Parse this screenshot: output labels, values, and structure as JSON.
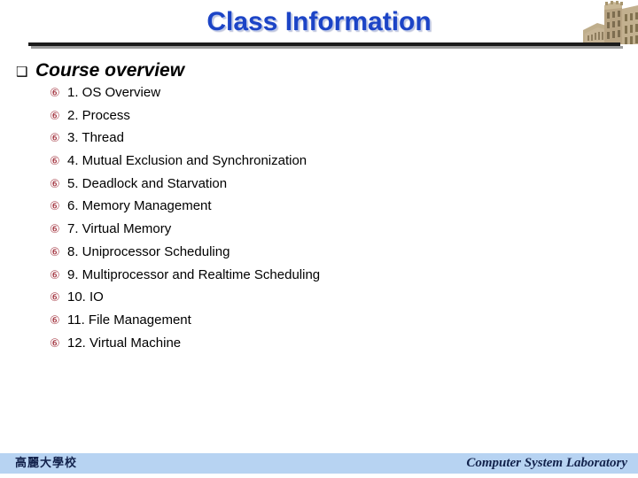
{
  "slide": {
    "title": "Class Information",
    "title_color": "#1c44c6"
  },
  "decor": {
    "building_image_name": "korea-university-building-photo",
    "rule_color": "#1b1b1b"
  },
  "body": {
    "section": {
      "bullet_glyph": "❑",
      "label": "Course overview"
    },
    "item_bullet_glyph": "⑥",
    "item_bullet_color": "#9e2a36",
    "items": [
      {
        "label": "1. OS Overview"
      },
      {
        "label": "2. Process"
      },
      {
        "label": "3. Thread"
      },
      {
        "label": "4. Mutual Exclusion and Synchronization"
      },
      {
        "label": "5. Deadlock and Starvation"
      },
      {
        "label": "6. Memory Management"
      },
      {
        "label": "7. Virtual Memory"
      },
      {
        "label": "8. Uniprocessor Scheduling"
      },
      {
        "label": "9. Multiprocessor and Realtime Scheduling"
      },
      {
        "label": "10. IO"
      },
      {
        "label": "11. File Management"
      },
      {
        "label": "12. Virtual Machine"
      }
    ]
  },
  "footer": {
    "background_color": "#b7d3f2",
    "left_text": "高麗大學校",
    "right_text": "Computer System Laboratory"
  }
}
